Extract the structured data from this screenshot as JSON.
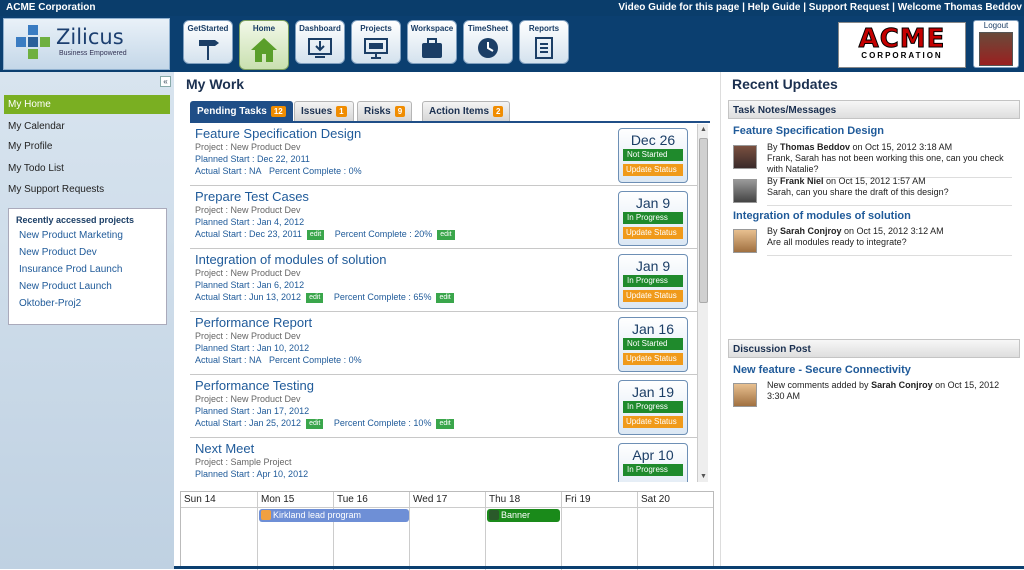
{
  "topbar": {
    "company": "ACME Corporation",
    "links": "Video Guide for this page | Help Guide | Support Request | Welcome Thomas Beddov"
  },
  "logo": {
    "name": "Zilicus",
    "tagline": "Business Empowered"
  },
  "nav": [
    {
      "label": "GetStarted",
      "icon": "signpost-icon"
    },
    {
      "label": "Home",
      "icon": "home-icon",
      "active": true
    },
    {
      "label": "Dashboard",
      "icon": "monitor-download-icon"
    },
    {
      "label": "Projects",
      "icon": "projector-icon"
    },
    {
      "label": "Workspace",
      "icon": "briefcase-icon"
    },
    {
      "label": "TimeSheet",
      "icon": "clock-icon"
    },
    {
      "label": "Reports",
      "icon": "report-icon"
    }
  ],
  "brand": {
    "big": "ACME",
    "small": "CORPORATION",
    "color": "#c40000"
  },
  "logout": {
    "label": "Logout"
  },
  "sidebar": {
    "collapse": "«",
    "items": [
      {
        "label": "My Home",
        "active": true
      },
      {
        "label": "My Calendar"
      },
      {
        "label": "My Profile"
      },
      {
        "label": "My Todo List"
      },
      {
        "label": "My Support Requests"
      }
    ],
    "recent_heading": "Recently accessed projects",
    "recent_projects": [
      "New Product Marketing",
      "New Product Dev",
      "Insurance Prod Launch",
      "New Product Launch",
      "Oktober-Proj2"
    ]
  },
  "mywork": {
    "title": "My Work",
    "tabs": [
      {
        "label": "Pending Tasks",
        "count": "12",
        "active": true
      },
      {
        "label": "Issues",
        "count": "1"
      },
      {
        "label": "Risks",
        "count": "9"
      },
      {
        "label": "Action Items",
        "count": "2"
      }
    ],
    "tasks": [
      {
        "title": "Feature Specification Design",
        "project": "Project : New Product Dev",
        "planned": "Planned Start : Dec 22, 2011",
        "actual": "Actual Start : NA",
        "percent": "Percent Complete : 0%",
        "edit": false,
        "date": "Dec 26",
        "status": "Not Started",
        "update": "Update Status"
      },
      {
        "title": "Prepare Test Cases",
        "project": "Project : New Product Dev",
        "planned": "Planned Start : Jan 4, 2012",
        "actual": "Actual Start : Dec 23, 2011",
        "percent": "Percent Complete : 20%",
        "edit": true,
        "date": "Jan 9",
        "status": "In Progress",
        "update": "Update Status"
      },
      {
        "title": "Integration of modules of solution",
        "project": "Project : New Product Dev",
        "planned": "Planned Start : Jan 6, 2012",
        "actual": "Actual Start : Jun 13, 2012",
        "percent": "Percent Complete : 65%",
        "edit": true,
        "date": "Jan 9",
        "status": "In Progress",
        "update": "Update Status"
      },
      {
        "title": "Performance Report",
        "project": "Project : New Product Dev",
        "planned": "Planned Start : Jan 10, 2012",
        "actual": "Actual Start : NA",
        "percent": "Percent Complete : 0%",
        "edit": false,
        "date": "Jan 16",
        "status": "Not Started",
        "update": "Update Status"
      },
      {
        "title": "Performance Testing",
        "project": "Project : New Product Dev",
        "planned": "Planned Start : Jan 17, 2012",
        "actual": "Actual Start : Jan 25, 2012",
        "percent": "Percent Complete : 10%",
        "edit": true,
        "date": "Jan 19",
        "status": "In Progress",
        "update": "Update Status"
      },
      {
        "title": "Next Meet",
        "project": "Project : Sample Project",
        "planned": "Planned Start : Apr 10, 2012",
        "actual": "",
        "percent": "",
        "edit": false,
        "date": "Apr 10",
        "status": "In Progress",
        "update": ""
      }
    ],
    "edit_label": "edit"
  },
  "calendar": {
    "days": [
      "Sun 14",
      "Mon 15",
      "Tue 16",
      "Wed 17",
      "Thu 18",
      "Fri 19",
      "Sat 20"
    ],
    "events": [
      {
        "label": "Kirkland lead program",
        "color": "#6e8fd6"
      },
      {
        "label": "Banner",
        "color": "#1a8a1a"
      }
    ]
  },
  "updates": {
    "title": "Recent Updates",
    "notes_heading": "Task Notes/Messages",
    "groups": [
      {
        "task": "Feature Specification Design",
        "notes": [
          {
            "by": "By ",
            "author": "Thomas Beddov",
            "when": " on Oct 15, 2012 3:18 AM",
            "text": "Frank, Sarah has not been working this one, can you check with Natalie?"
          },
          {
            "by": "By ",
            "author": "Frank Niel",
            "when": " on Oct 15, 2012 1:57 AM",
            "text": "Sarah, can you share the draft of this design?"
          }
        ]
      },
      {
        "task": "Integration of modules of solution",
        "notes": [
          {
            "by": "By ",
            "author": "Sarah Conjroy",
            "when": " on Oct 15, 2012 3:12 AM",
            "text": "Are all modules ready to integrate?"
          }
        ]
      }
    ],
    "discussion_heading": "Discussion Post",
    "discussion": {
      "title": "New feature - Secure Connectivity",
      "pre": "New comments added by ",
      "author": "Sarah Conjroy",
      "when": " on Oct 15, 2012 3:30 AM"
    }
  }
}
